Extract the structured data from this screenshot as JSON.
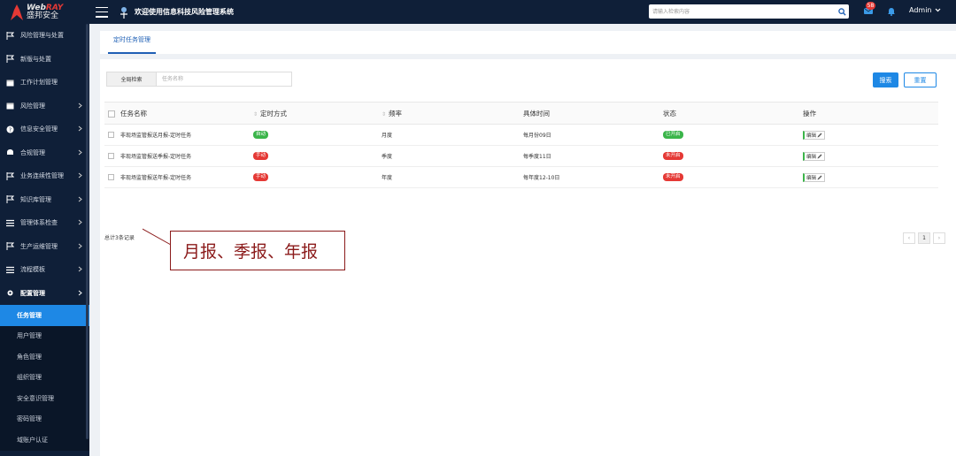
{
  "header": {
    "logo_en_a": "Web",
    "logo_en_b": "RAY",
    "logo_cn": "盛邦安全",
    "system_title": "欢迎使用信息科技风险管理系统",
    "search_placeholder": "请输入检索内容",
    "message_count": "58",
    "user": "Admin"
  },
  "sidebar": {
    "items": [
      {
        "label": "风险管理与处置"
      },
      {
        "label": "新版与处置"
      },
      {
        "label": "工作计划管理"
      },
      {
        "label": "风险管理"
      },
      {
        "label": "信息安全管理"
      },
      {
        "label": "合规管理"
      },
      {
        "label": "业务连续性管理"
      },
      {
        "label": "知识库管理"
      },
      {
        "label": "管理体系检查"
      },
      {
        "label": "生产运维管理"
      },
      {
        "label": "流程模板"
      },
      {
        "label": "配置管理"
      }
    ],
    "subitems": [
      {
        "label": "任务管理"
      },
      {
        "label": "用户管理"
      },
      {
        "label": "角色管理"
      },
      {
        "label": "组织管理"
      },
      {
        "label": "安全意识管理"
      },
      {
        "label": "密码管理"
      },
      {
        "label": "域账户认证"
      }
    ]
  },
  "tab": {
    "label": "定时任务管理"
  },
  "filter": {
    "label": "全局检索",
    "placeholder": "任务名称",
    "search_label": "搜索",
    "reset_label": "重置"
  },
  "table": {
    "headers": [
      "任务名称",
      "定时方式",
      "频率",
      "具体时间",
      "状态",
      "操作"
    ],
    "rows": [
      {
        "name": "非现场监管报送月报-定时任务",
        "mode": "自动",
        "freq": "月度",
        "time": "每月份09日",
        "status": "已开启",
        "action": "编辑"
      },
      {
        "name": "非现场监管报送季报-定时任务",
        "mode": "手动",
        "freq": "季度",
        "time": "每季度11日",
        "status": "未开启",
        "action": "编辑"
      },
      {
        "name": "非现场监管报送年报-定时任务",
        "mode": "手动",
        "freq": "年度",
        "time": "每年度12-10日",
        "status": "未开启",
        "action": "编辑"
      }
    ]
  },
  "footer": {
    "total": "总计3条记录",
    "page_prev": "‹",
    "page_current": "1",
    "page_next": "›"
  },
  "callout": {
    "text": "月报、季报、年报"
  },
  "colors": {
    "sidebar_bg": "#0f1f38",
    "accent": "#1e88e5",
    "status_on": "#3bb54a",
    "status_off": "#e53935"
  },
  "icons": {
    "menu": "hamburger-icon",
    "search": "search-icon",
    "message": "message-icon",
    "bell": "bell-icon",
    "edit": "edit-icon"
  }
}
